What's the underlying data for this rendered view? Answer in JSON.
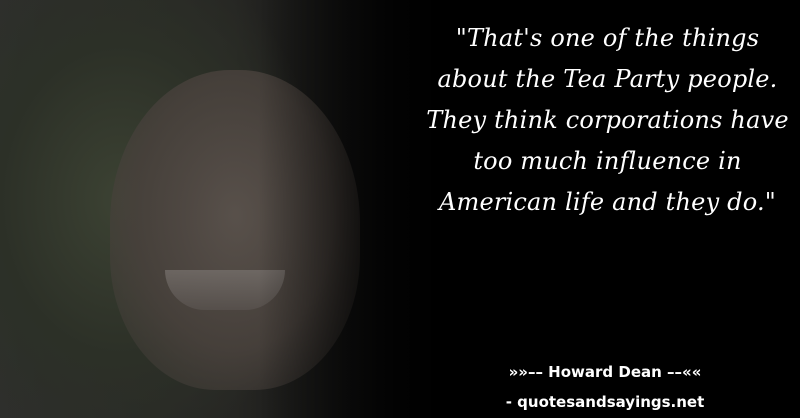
{
  "quote": {
    "text": "\"That's one of the things about the Tea Party people. They think corporations have too much influence in American life and they do.\""
  },
  "attribution": {
    "author_line": "»»–– Howard Dean ––««",
    "site_line": "- quotesandsayings.net"
  },
  "colors": {
    "background": "#000000",
    "text": "#ffffff"
  }
}
